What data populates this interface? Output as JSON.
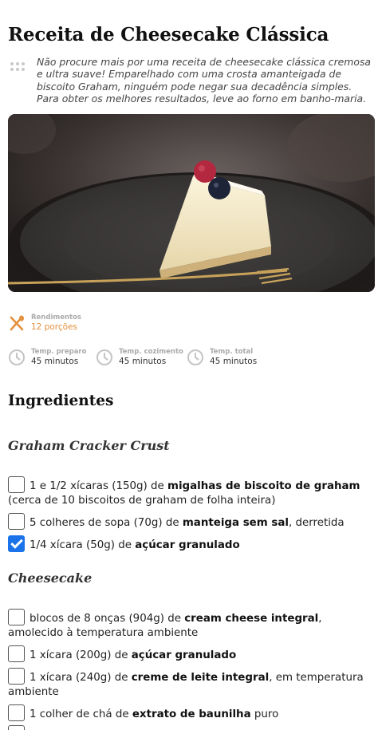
{
  "recipe": {
    "title": "Receita de Cheesecake Clássica",
    "intro": "Não procure mais por uma receita de cheesecake clássica cremosa e ultra suave! Emparelhado com uma crosta amanteigada de biscoito Graham, ninguém pode negar sua decadência simples. Para obter os melhores resultados, leve ao forno em banho-maria."
  },
  "meta": {
    "yield_label": "Rendimentos",
    "yield_value": "12 porções",
    "prep_label": "Temp. preparo",
    "prep_value": "45 minutos",
    "cook_label": "Temp. cozimento",
    "cook_value": "45 minutos",
    "total_label": "Temp. total",
    "total_value": "45 minutos"
  },
  "ingredients": {
    "heading": "Ingredientes",
    "groups": [
      {
        "title": "Graham Cracker Crust",
        "items": [
          {
            "pre": "1 e 1/2 xícaras (150g) de ",
            "bold": "migalhas de biscoito de graham",
            "post": " (cerca de 10 biscoitos de graham de folha inteira)",
            "checked": false
          },
          {
            "pre": "5 colheres de sopa (70g) de ",
            "bold": "manteiga sem sal",
            "post": ", derretida",
            "checked": false
          },
          {
            "pre": "1/4 xícara (50g) de ",
            "bold": "açúcar granulado",
            "post": "",
            "checked": true
          }
        ]
      },
      {
        "title": "Cheesecake",
        "items": [
          {
            "pre": "blocos de 8 onças (904g) de ",
            "bold": "cream cheese integral",
            "post": ", amolecido à temperatura ambiente",
            "checked": false
          },
          {
            "pre": "1 xícara (200g) de ",
            "bold": "açúcar granulado",
            "post": "",
            "checked": false
          },
          {
            "pre": "1 xícara (240g) de ",
            "bold": "creme de leite integral",
            "post": ", em temperatura ambiente",
            "checked": false
          },
          {
            "pre": "1 colher de chá de ",
            "bold": "extrato de baunilha",
            "post": " puro",
            "checked": false
          }
        ]
      }
    ]
  },
  "colors": {
    "accent": "#e5903e",
    "checkbox_checked": "#1a73e8"
  },
  "icons": {
    "drag": "drag-handle-icon",
    "yield": "fork-spoon-icon",
    "time": "clock-icon"
  }
}
